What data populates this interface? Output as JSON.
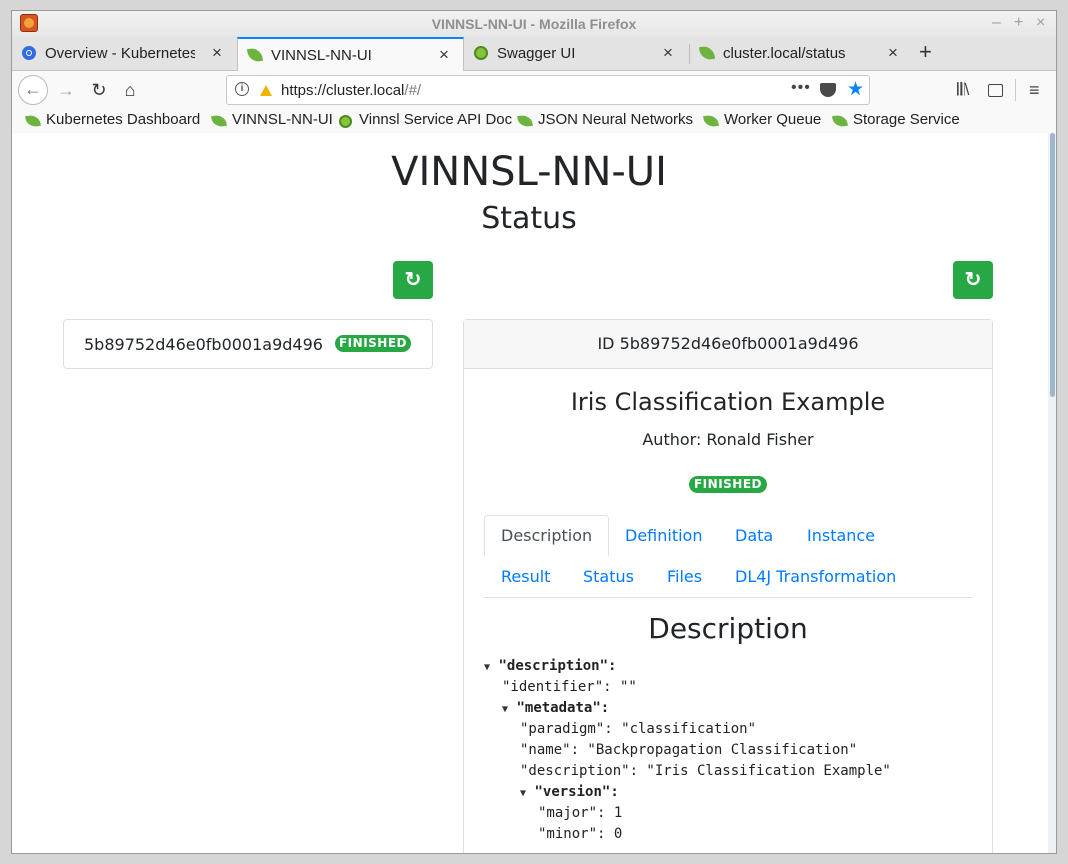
{
  "window": {
    "title": "VINNSL-NN-UI - Mozilla Firefox"
  },
  "tabs": [
    {
      "label": "Overview - Kubernetes Dashboard",
      "icon": "kubernetes-icon"
    },
    {
      "label": "VINNSL-NN-UI",
      "icon": "leaf-icon",
      "active": true
    },
    {
      "label": "Swagger UI",
      "icon": "swagger-icon"
    },
    {
      "label": "cluster.local/status",
      "icon": "leaf-icon"
    }
  ],
  "navbar": {
    "url_host": "https://cluster.local",
    "url_path": "/#/",
    "more": "•••"
  },
  "bookmarks": [
    {
      "label": "Kubernetes Dashboard",
      "icon": "leaf-icon"
    },
    {
      "label": "VINNSL-NN-UI",
      "icon": "leaf-icon"
    },
    {
      "label": "Vinnsl Service API Doc",
      "icon": "swagger-icon"
    },
    {
      "label": "JSON Neural Networks",
      "icon": "leaf-icon"
    },
    {
      "label": "Worker Queue",
      "icon": "leaf-icon"
    },
    {
      "label": "Storage Service",
      "icon": "leaf-icon"
    }
  ],
  "page": {
    "title": "VINNSL-NN-UI",
    "subtitle": "Status",
    "refresh_icon": "↻",
    "list": [
      {
        "id": "5b89752d46e0fb0001a9d496",
        "status": "FINISHED"
      }
    ],
    "detail": {
      "header": "ID 5b89752d46e0fb0001a9d496",
      "title": "Iris Classification Example",
      "author": "Author: Ronald Fisher",
      "status": "FINISHED",
      "tabs": [
        "Description",
        "Definition",
        "Data",
        "Instance",
        "Result",
        "Status",
        "Files",
        "DL4J Transformation"
      ],
      "section_title": "Description",
      "json": {
        "l1": "\"description\":",
        "l2": "\"identifier\": \"\"",
        "l3": "\"metadata\":",
        "l4": "\"paradigm\": \"classification\"",
        "l5": "\"name\": \"Backpropagation Classification\"",
        "l6": "\"description\": \"Iris Classification Example\"",
        "l7": "\"version\":",
        "l8": "\"major\": 1",
        "l9": "\"minor\": 0"
      }
    }
  },
  "colors": {
    "success": "#28a745",
    "link": "#007bff",
    "accent": "#0a84ff"
  }
}
